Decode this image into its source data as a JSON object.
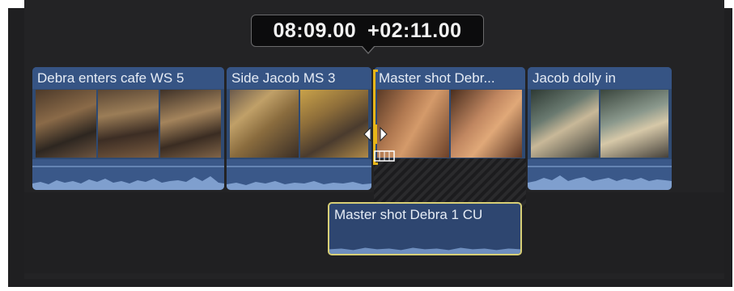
{
  "timecode": {
    "position": "08:09.00",
    "delta": "+02:11.00"
  },
  "clips": [
    {
      "title": "Debra enters cafe WS 5"
    },
    {
      "title": "Side Jacob MS 3"
    },
    {
      "title": "Master shot Debr..."
    },
    {
      "title": "Jacob dolly in"
    }
  ],
  "connected_clip": {
    "title": "Master shot Debra 1 CU"
  },
  "colors": {
    "clip_title": "#365484",
    "clip_body": "#2f4a72",
    "trim_edge": "#e7b518",
    "connected_border": "#d8cf76"
  },
  "icons": [
    "ripple-trim-icon",
    "filmstrip-icon"
  ]
}
